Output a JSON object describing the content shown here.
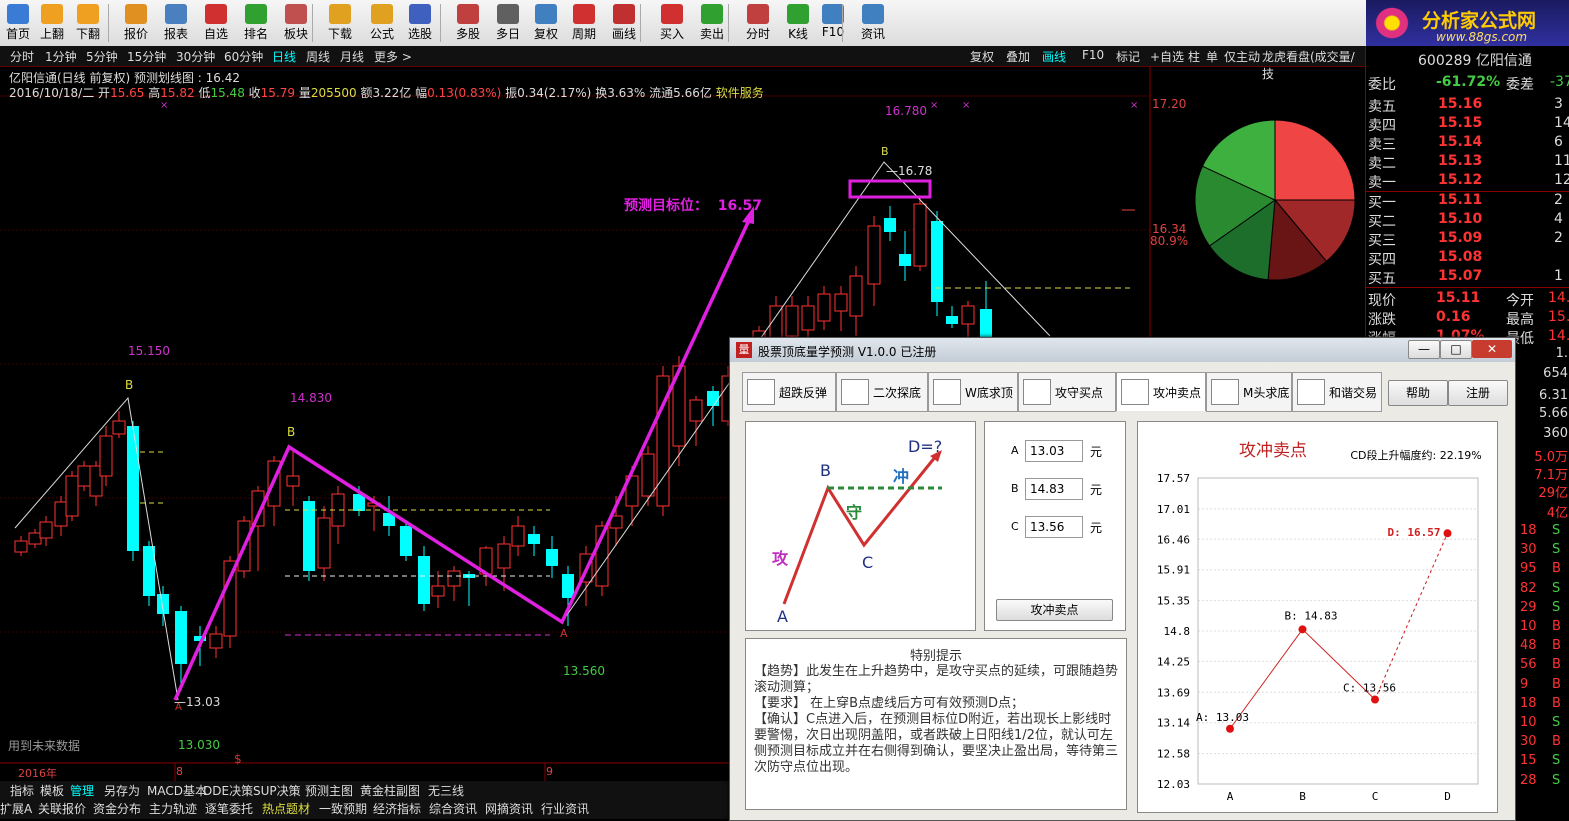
{
  "toolbar": {
    "items": [
      {
        "label": "首页",
        "icon": "home-icon",
        "color": "#3a7bd5"
      },
      {
        "label": "上翻",
        "icon": "arrow-up-icon",
        "color": "#f0a020"
      },
      {
        "label": "下翻",
        "icon": "arrow-down-icon",
        "color": "#f0a020"
      },
      {
        "label": "报价",
        "icon": "yen-icon",
        "color": "#e09020"
      },
      {
        "label": "报表",
        "icon": "report-icon",
        "color": "#4a80c0"
      },
      {
        "label": "自选",
        "icon": "f6-icon",
        "color": "#d03030"
      },
      {
        "label": "排名",
        "icon": "rank-icon",
        "color": "#30a030"
      },
      {
        "label": "板块",
        "icon": "grid-icon",
        "color": "#c05050"
      },
      {
        "label": "下载",
        "icon": "download-icon",
        "color": "#e0a020"
      },
      {
        "label": "公式",
        "icon": "fx-icon",
        "color": "#e0a020"
      },
      {
        "label": "选股",
        "icon": "select-icon",
        "color": "#4060c0"
      },
      {
        "label": "多股",
        "icon": "mountain-icon",
        "color": "#c04040"
      },
      {
        "label": "多日",
        "icon": "clock-icon",
        "color": "#606060"
      },
      {
        "label": "复权",
        "icon": "restore-icon",
        "color": "#4080c0"
      },
      {
        "label": "周期",
        "icon": "f8-icon",
        "color": "#d03030"
      },
      {
        "label": "画线",
        "icon": "pen-icon",
        "color": "#c03030"
      },
      {
        "label": "买入",
        "icon": "buy-icon",
        "color": "#d03030"
      },
      {
        "label": "卖出",
        "icon": "sell-icon",
        "color": "#30a030"
      },
      {
        "label": "分时",
        "icon": "timeline-icon",
        "color": "#c04040"
      },
      {
        "label": "K线",
        "icon": "kline-icon",
        "color": "#30a030"
      },
      {
        "label": "F10",
        "icon": "f10-icon",
        "color": "#4080c0"
      },
      {
        "label": "资讯",
        "icon": "news-icon",
        "color": "#4080c0"
      }
    ],
    "logo_text": "分析家公式网",
    "logo_url": "www.88gs.com"
  },
  "periods": [
    "分时",
    "1分钟",
    "5分钟",
    "15分钟",
    "30分钟",
    "60分钟",
    "日线",
    "周线",
    "月线",
    "更多 >"
  ],
  "active_period": "日线",
  "right_buttons": [
    "复权",
    "叠加",
    "画线",
    "F10",
    "标记",
    "+自选",
    "柱",
    "单",
    "仅主动",
    "龙虎看盘(成交量/技"
  ],
  "stock": {
    "code": "600289 亿阳信通",
    "title_line": "亿阳信通(日线 前复权) 预测划线图 : 16.42",
    "date": "2016/10/18/二",
    "open_label": "开",
    "open": "15.65",
    "high_label": "高",
    "high": "15.82",
    "low_label": "低",
    "low": "15.48",
    "close_label": "收",
    "close": "15.79",
    "vol_label": "量",
    "vol": "205500",
    "amt_label": "额",
    "amt": "3.22亿",
    "chg_label": "幅",
    "chg": "0.13(0.83%)",
    "amp_label": "振",
    "amp": "0.34(2.17%)",
    "turn_label": "换",
    "turn": "3.63%",
    "float_label": "流通",
    "float": "5.66亿",
    "service": "软件服务"
  },
  "chart_labels": {
    "high1": "15.150",
    "b1": "B",
    "low1": "13.03",
    "low1b": "13.030",
    "high2": "14.830",
    "b2": "B",
    "low2": "13.560",
    "a2": "A",
    "high3": "16.780",
    "b3": "B",
    "b3val": "16.78",
    "target_label": "预测目标位：",
    "target": "16.57",
    "axis_top": "17.20",
    "axis_mid": "16.34",
    "axis_pct": "80.9%",
    "future_data": "用到未来数据",
    "date_year": "2016年",
    "date_8": "8",
    "date_9": "9",
    "marker_s": "$",
    "a1": "A"
  },
  "bottom1": [
    "指标",
    "模板",
    "管理",
    "另存为",
    "MACD基本",
    "DDE决策",
    "SUP决策",
    "预测主图",
    "黄金柱副图",
    "无三线"
  ],
  "bottom1_active": "管理",
  "bottom2": [
    "扩展A",
    "关联报价",
    "资金分布",
    "主力轨迹",
    "逐笔委托",
    "热点题材",
    "一致预期",
    "经济指标",
    "综合资讯",
    "网摘资讯",
    "行业资讯"
  ],
  "quote": {
    "wb_label": "委比",
    "wb": "-61.72%",
    "wc_label": "委差",
    "wc": "-37",
    "asks": [
      {
        "l": "卖五",
        "p": "15.16",
        "v": "3"
      },
      {
        "l": "卖四",
        "p": "15.15",
        "v": "14"
      },
      {
        "l": "卖三",
        "p": "15.14",
        "v": "6"
      },
      {
        "l": "卖二",
        "p": "15.13",
        "v": "11"
      },
      {
        "l": "卖一",
        "p": "15.12",
        "v": "12"
      }
    ],
    "bids": [
      {
        "l": "买一",
        "p": "15.11",
        "v": "2"
      },
      {
        "l": "买二",
        "p": "15.10",
        "v": "4"
      },
      {
        "l": "买三",
        "p": "15.09",
        "v": "2"
      },
      {
        "l": "买四",
        "p": "15.08",
        "v": ""
      },
      {
        "l": "买五",
        "p": "15.07",
        "v": "1"
      }
    ],
    "now_label": "现价",
    "now": "15.11",
    "open_label": "今开",
    "open": "14.",
    "zd_label": "涨跌",
    "zd": "0.16",
    "high_label": "最高",
    "high": "15.",
    "zf_label": "涨幅",
    "zf": "1.07%",
    "low_label": "最低",
    "low": "14.",
    "side_vals": [
      "1.",
      "654",
      "6.31",
      "5.66",
      "360",
      "5.0万",
      "7.1万",
      "29亿",
      "4亿"
    ],
    "ticks": [
      {
        "v": "18",
        "s": "S"
      },
      {
        "v": "30",
        "s": "S"
      },
      {
        "v": "95",
        "s": "B"
      },
      {
        "v": "82",
        "s": "S"
      },
      {
        "v": "29",
        "s": "S"
      },
      {
        "v": "10",
        "s": "B"
      },
      {
        "v": "48",
        "s": "B"
      },
      {
        "v": "56",
        "s": "B"
      },
      {
        "v": "9",
        "s": "B"
      },
      {
        "v": "18",
        "s": "B"
      },
      {
        "v": "10",
        "s": "S"
      },
      {
        "v": "30",
        "s": "B"
      },
      {
        "v": "15",
        "s": "S"
      },
      {
        "v": "28",
        "s": "S"
      }
    ]
  },
  "dialog": {
    "title": "股票顶底量学预测 V1.0.0 已注册",
    "tabs": [
      "超跌反弹",
      "二次探底",
      "W底求顶",
      "攻守买点",
      "攻冲卖点",
      "M头求底",
      "和谐交易"
    ],
    "active_tab": "攻冲卖点",
    "help": "帮助",
    "register": "注册",
    "diagram": {
      "d": "D=?",
      "b": "B",
      "c": "C",
      "a": "A",
      "attack": "攻",
      "defend": "守",
      "charge": "冲"
    },
    "fields": [
      {
        "label": "A",
        "value": "13.03",
        "unit": "元"
      },
      {
        "label": "B",
        "value": "14.83",
        "unit": "元"
      },
      {
        "label": "C",
        "value": "13.56",
        "unit": "元"
      }
    ],
    "calc_button": "攻冲卖点",
    "tips_title": "特别提示",
    "tips": [
      "【趋势】此发生在上升趋势中，是攻守买点的延续，可跟随趋势滚动测算；",
      "【要求】 在上穿B点虚线后方可有效预测D点；",
      "【确认】C点进入后，在预测目标位D附近，若出现长上影线时要警惕，次日出现阴盖阳，或者跌破上日阳线1/2位，就认可左侧预测目标成立并在右侧得到确认，要坚决止盈出局，等待第三次防守点位出现。"
    ],
    "window_buttons": [
      "—",
      "□",
      "✕"
    ]
  },
  "chart_data": {
    "type": "line",
    "title": "攻冲卖点",
    "subtitle": "CD段上升幅度约: 22.19%",
    "categories": [
      "A",
      "B",
      "C",
      "D"
    ],
    "values": [
      13.03,
      14.83,
      13.56,
      16.57
    ],
    "point_labels": [
      "A: 13.03",
      "B: 14.83",
      "C: 13.56",
      "D: 16.57"
    ],
    "yticks": [
      "17.57",
      "17.01",
      "16.46",
      "15.91",
      "15.35",
      "14.8",
      "14.25",
      "13.69",
      "13.14",
      "12.58",
      "12.03"
    ],
    "ylim": [
      12.03,
      17.57
    ],
    "grid": true,
    "colors": {
      "line": "#d02020",
      "dashed": "#d02020",
      "point": "#e01010"
    }
  }
}
